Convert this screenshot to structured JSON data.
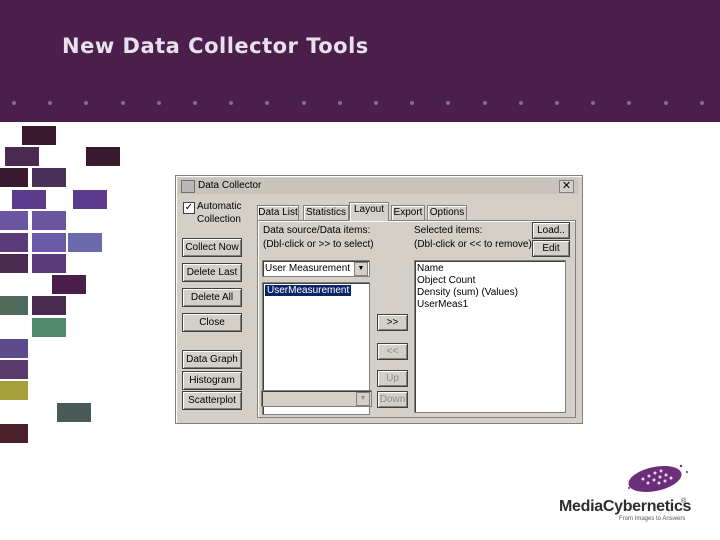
{
  "slide": {
    "title": "New Data Collector Tools",
    "logo_text": "MediaCybernetics",
    "logo_reg": "®",
    "tagline": "From Images to Answers"
  },
  "colors": {
    "banner": "#4a1f4c",
    "accent_purple": "#5c3a8c",
    "accent_green": "#4f8a6a",
    "accent_olive": "#a6a03a"
  },
  "dialog": {
    "title": "Data Collector",
    "close_glyph": "✕",
    "auto_checkbox": {
      "checked": true,
      "mark": "✓",
      "line1": "Automatic",
      "line2": "Collection"
    },
    "buttons": {
      "collect_now": "Collect Now",
      "delete_last": "Delete Last",
      "delete_all": "Delete All",
      "close": "Close",
      "data_graph": "Data Graph",
      "histogram": "Histogram",
      "scatterplot": "Scatterplot"
    },
    "tabs": [
      "Data List",
      "Statistics",
      "Layout",
      "Export",
      "Options"
    ],
    "active_tab": "Layout",
    "layout": {
      "source_label": "Data source/Data items:",
      "source_hint": "(Dbl-click or >> to select)",
      "selected_label": "Selected items:",
      "selected_hint": "(Dbl-click or << to remove)",
      "source_combo": "User Measurement",
      "source_items": [
        "UserMeasurement"
      ],
      "selected_items": [
        "Name",
        "Object Count",
        "Density (sum) (Values)",
        "UserMeas1"
      ],
      "buttons": {
        "load": "Load..",
        "edit": "Edit",
        "add": ">>",
        "remove": "<<",
        "up": "Up",
        "down": "Down"
      }
    }
  }
}
